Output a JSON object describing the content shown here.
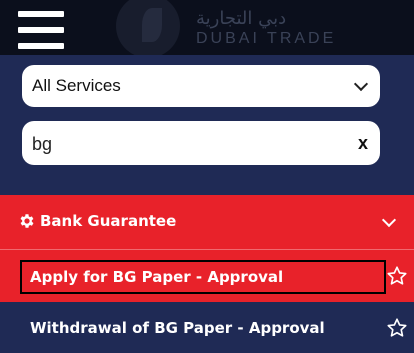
{
  "header": {
    "logo_arabic": "دبي التجارية",
    "logo_english": "DUBAI TRADE"
  },
  "filters": {
    "service_select_value": "All Services",
    "search_value": "bg",
    "clear_label": "x"
  },
  "category": {
    "label": "Bank Guarantee",
    "icon": "gear-icon"
  },
  "items": [
    {
      "label": "Apply for BG Paper - Approval",
      "icon": "star-outline-icon"
    },
    {
      "label": "Withdrawal of BG Paper - Approval",
      "icon": "star-outline-icon"
    }
  ],
  "colors": {
    "topbar": "#0b0f1c",
    "panel": "#1f2a55",
    "accent_red": "#e8222a",
    "white": "#ffffff"
  }
}
